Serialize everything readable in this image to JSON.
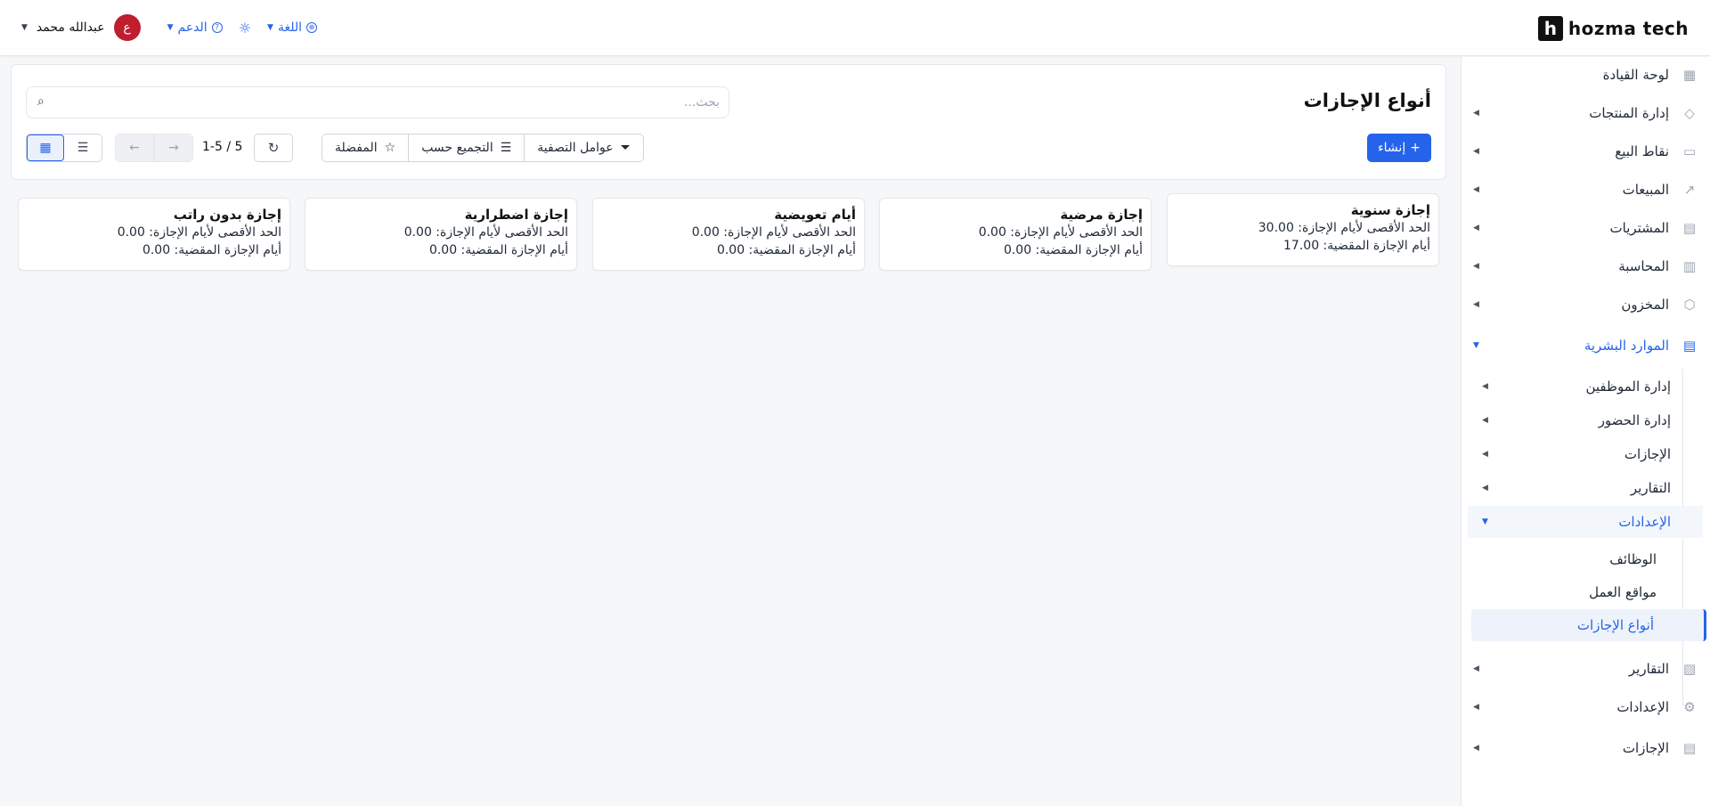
{
  "topbar": {
    "logo_mark": "h",
    "logo_text": "hozma tech",
    "user_name": "عبدالله محمد",
    "avatar_letter": "ع",
    "support_label": "الدعم",
    "language_label": "اللغة"
  },
  "sidebar": {
    "items": [
      {
        "label": "لوحة القيادة",
        "icon": "grid-icon"
      },
      {
        "label": "إدارة المنتجات",
        "icon": "tag-icon"
      },
      {
        "label": "نقاط البيع",
        "icon": "store-icon"
      },
      {
        "label": "المبيعات",
        "icon": "chart-line-icon"
      },
      {
        "label": "المشتريات",
        "icon": "cart-icon"
      },
      {
        "label": "المحاسبة",
        "icon": "calculator-icon"
      },
      {
        "label": "المخزون",
        "icon": "box-icon"
      },
      {
        "label": "الموارد البشرية",
        "icon": "document-icon"
      }
    ],
    "hr_children": [
      {
        "label": "إدارة الموظفين"
      },
      {
        "label": "إدارة الحضور"
      },
      {
        "label": "الإجازات"
      },
      {
        "label": "التقارير"
      },
      {
        "label": "الإعدادات"
      }
    ],
    "settings_children": [
      {
        "label": "الوظائف"
      },
      {
        "label": "مواقع العمل"
      },
      {
        "label": "أنواع الإجازات"
      }
    ],
    "bottom_items": [
      {
        "label": "التقارير",
        "icon": "report-icon"
      },
      {
        "label": "الإعدادات",
        "icon": "gear-icon"
      },
      {
        "label": "الإجازات",
        "icon": "list-doc-icon"
      }
    ]
  },
  "main": {
    "title": "أنواع الإجازات",
    "search_placeholder": "بحث...",
    "create_label": "إنشاء",
    "filters_label": "عوامل التصفية",
    "group_by_label": "التجميع حسب",
    "favorites_label": "المفضلة",
    "pager_text": "1-5 / 5"
  },
  "cards": [
    {
      "title": "إجازة سنوية",
      "max_line": "الحد الأقصى لأيام الإجازة: 30.00",
      "used_line": "أيام الإجازة المقضية: 17.00"
    },
    {
      "title": "إجازة مرضية",
      "max_line": "الحد الأقصى لأيام الإجازة: 0.00",
      "used_line": "أيام الإجازة المقضية: 0.00"
    },
    {
      "title": "أيام تعويضية",
      "max_line": "الحد الأقصى لأيام الإجازة: 0.00",
      "used_line": "أيام الإجازة المقضية: 0.00"
    },
    {
      "title": "إجازة اضطرارية",
      "max_line": "الحد الأقصى لأيام الإجازة: 0.00",
      "used_line": "أيام الإجازة المقضية: 0.00"
    },
    {
      "title": "إجازة بدون راتب",
      "max_line": "الحد الأقصى لأيام الإجازة: 0.00",
      "used_line": "أيام الإجازة المقضية: 0.00"
    }
  ],
  "colors": {
    "accent": "#2563eb",
    "avatar": "#be1e2d"
  }
}
